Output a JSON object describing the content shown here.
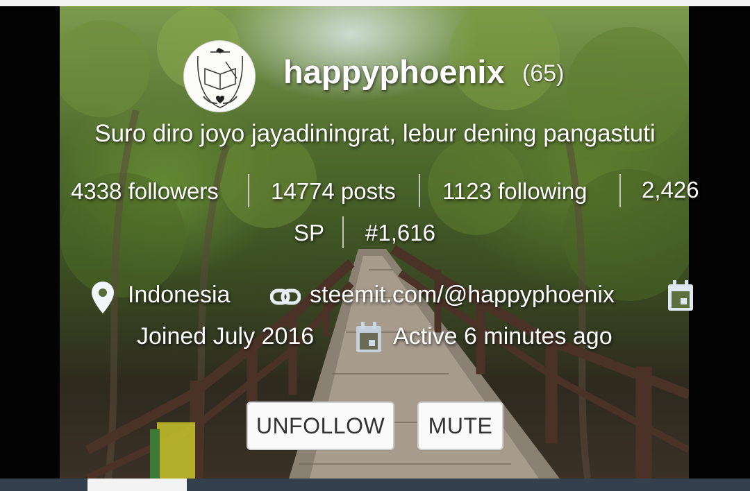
{
  "profile": {
    "username": "happyphoenix",
    "reputation": "(65)",
    "about": "Suro diro joyo jayadiningrat, lebur dening pangastuti"
  },
  "stats": {
    "followers": "4338 followers",
    "posts": "14774 posts",
    "following": "1123 following",
    "sp_amount": "2,426",
    "sp_unit": "SP",
    "rank": "#1,616"
  },
  "info": {
    "location": "Indonesia",
    "website": "steemit.com/@happyphoenix",
    "joined": "Joined July 2016",
    "active": "Active 6 minutes ago"
  },
  "actions": {
    "unfollow_label": "UNFOLLOW",
    "mute_label": "MUTE"
  },
  "icons": {
    "avatar": "crest-logo-icon",
    "location": "map-pin-icon",
    "website": "link-icon",
    "joined": "calendar-icon",
    "active": "calendar-icon"
  },
  "colors": {
    "tab_bar": "#34404b",
    "button_bg": "#fafafa",
    "button_text": "#333333",
    "text": "#ffffff"
  }
}
